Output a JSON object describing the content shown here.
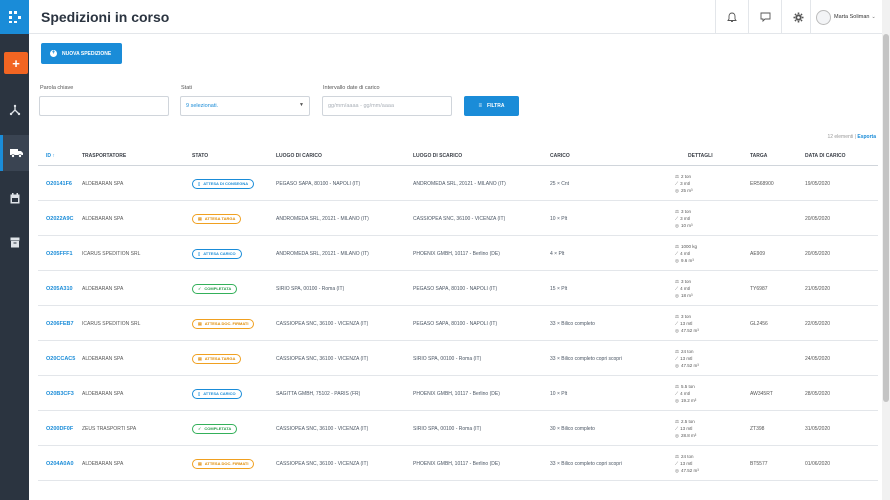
{
  "sidebar": {
    "logo_icon": "logo-icon",
    "add_icon": "plus-icon",
    "items": [
      {
        "name": "routes-icon"
      },
      {
        "name": "truck-icon",
        "active": true
      },
      {
        "name": "calendar-icon"
      },
      {
        "name": "archive-icon"
      }
    ]
  },
  "header": {
    "title": "Spedizioni in corso",
    "icons": [
      "bell-icon",
      "chat-icon",
      "gear-icon"
    ],
    "user_name": "Marta Soliman"
  },
  "toolbar": {
    "new_shipment_label": "NUOVA SPEDIZIONE"
  },
  "filters": {
    "keyword_label": "Parola chiave",
    "keyword_value": "",
    "states_label": "Stati",
    "states_value": "9 selezionati.",
    "dates_label": "Intervallo date di carico",
    "dates_placeholder": "gg/mm/aaaa - gg/mm/aaaa",
    "filter_button": "FILTRA"
  },
  "summary": {
    "count_text": "12 elementi |",
    "export_label": "Esporta"
  },
  "table": {
    "columns": [
      "ID",
      "TRASPORTATORE",
      "STATO",
      "LUOGO DI CARICO",
      "LUOGO DI SCARICO",
      "CARICO",
      "DETTAGLI",
      "TARGA",
      "DATA DI CARICO"
    ],
    "rows": [
      {
        "id": "O20141F6",
        "carrier": "ALDEBARAN SPA",
        "status": "ATTESA DI CONSEGNA",
        "status_color": "blue",
        "load": "PEGASO SAPA, 80100 - NAPOLI (IT)",
        "unload": "ANDROMEDA SRL, 20121 - MILANO (IT)",
        "cargo": "25 × Cnt",
        "details": [
          "2 ton",
          "3 mtl",
          "25 m³"
        ],
        "plate": "ER568900",
        "date": "19/05/2020"
      },
      {
        "id": "O2022A9C",
        "carrier": "ALDEBARAN SPA",
        "status": "ATTESA TARGA",
        "status_color": "orange",
        "load": "ANDROMEDA SRL, 20121 - MILANO (IT)",
        "unload": "CASSIOPEA SNC, 36100 - VICENZA (IT)",
        "cargo": "10 × Plt",
        "details": [
          "3 ton",
          "3 mtl",
          "10 m³"
        ],
        "plate": "",
        "date": "20/05/2020"
      },
      {
        "id": "O205FFF1",
        "carrier": "ICARUS SPEDITION SRL",
        "status": "ATTESA CARICO",
        "status_color": "blue",
        "load": "ANDROMEDA SRL, 20121 - MILANO (IT)",
        "unload": "PHOENIX GMBH, 10117 - Berlino (DE)",
        "cargo": "4 × Plt",
        "details": [
          "1000 kg",
          "4 mtl",
          "9.6 m³"
        ],
        "plate": "AE909",
        "date": "20/05/2020"
      },
      {
        "id": "O205A310",
        "carrier": "ALDEBARAN SPA",
        "status": "COMPLETATA",
        "status_color": "green",
        "load": "SIRIO SPA, 00100 - Roma (IT)",
        "unload": "PEGASO SAPA, 80100 - NAPOLI (IT)",
        "cargo": "15 × Plt",
        "details": [
          "3 ton",
          "4 mtl",
          "18 m³"
        ],
        "plate": "TY6987",
        "date": "21/05/2020"
      },
      {
        "id": "O206FEB7",
        "carrier": "ICARUS SPEDITION SRL",
        "status": "ATTESA DOC. FIRMATI",
        "status_color": "orange",
        "load": "CASSIOPEA SNC, 36100 - VICENZA (IT)",
        "unload": "PEGASO SAPA, 80100 - NAPOLI (IT)",
        "cargo": "33 × Bilico completo",
        "details": [
          "3 ton",
          "13 mtl",
          "47.52 m³"
        ],
        "plate": "GL2456",
        "date": "22/05/2020"
      },
      {
        "id": "O20CCAC5",
        "carrier": "ALDEBARAN SPA",
        "status": "ATTESA TARGA",
        "status_color": "orange",
        "load": "CASSIOPEA SNC, 36100 - VICENZA (IT)",
        "unload": "SIRIO SPA, 00100 - Roma (IT)",
        "cargo": "33 × Bilico completo copri scopri",
        "details": [
          "24 ton",
          "13 mtl",
          "47.52 m³"
        ],
        "plate": "",
        "date": "24/05/2020"
      },
      {
        "id": "O20B3CF3",
        "carrier": "ALDEBARAN SPA",
        "status": "ATTESA CARICO",
        "status_color": "blue",
        "load": "SAGITTA GMBH, 75102 - PARIS (FR)",
        "unload": "PHOENIX GMBH, 10117 - Berlino (DE)",
        "cargo": "10 × Plt",
        "details": [
          "5.5 ton",
          "4 mtl",
          "19.2 m³"
        ],
        "plate": "AW345RT",
        "date": "28/05/2020"
      },
      {
        "id": "O200DF0F",
        "carrier": "ZEUS TRASPORTI SPA",
        "status": "COMPLETATA",
        "status_color": "green",
        "load": "CASSIOPEA SNC, 36100 - VICENZA (IT)",
        "unload": "SIRIO SPA, 00100 - Roma (IT)",
        "cargo": "30 × Bilico completo",
        "details": [
          "2.5 ton",
          "13 mtl",
          "28.8 m³"
        ],
        "plate": "ZT398",
        "date": "31/05/2020"
      },
      {
        "id": "O204A0A0",
        "carrier": "ALDEBARAN SPA",
        "status": "ATTESA DOC. FIRMATI",
        "status_color": "orange",
        "load": "CASSIOPEA SNC, 36100 - VICENZA (IT)",
        "unload": "PHOENIX GMBH, 10117 - Berlino (DE)",
        "cargo": "33 × Bilico completo copri scopri",
        "details": [
          "24 ton",
          "13 mtl",
          "47.52 m³"
        ],
        "plate": "BT5577",
        "date": "01/06/2020"
      }
    ]
  },
  "colors": {
    "accent": "#1a8cd8",
    "sidebar": "#2b3440",
    "add_button": "#f26522",
    "status_blue": "#1a8cd8",
    "status_orange": "#f0a020",
    "status_green": "#34b05a"
  }
}
